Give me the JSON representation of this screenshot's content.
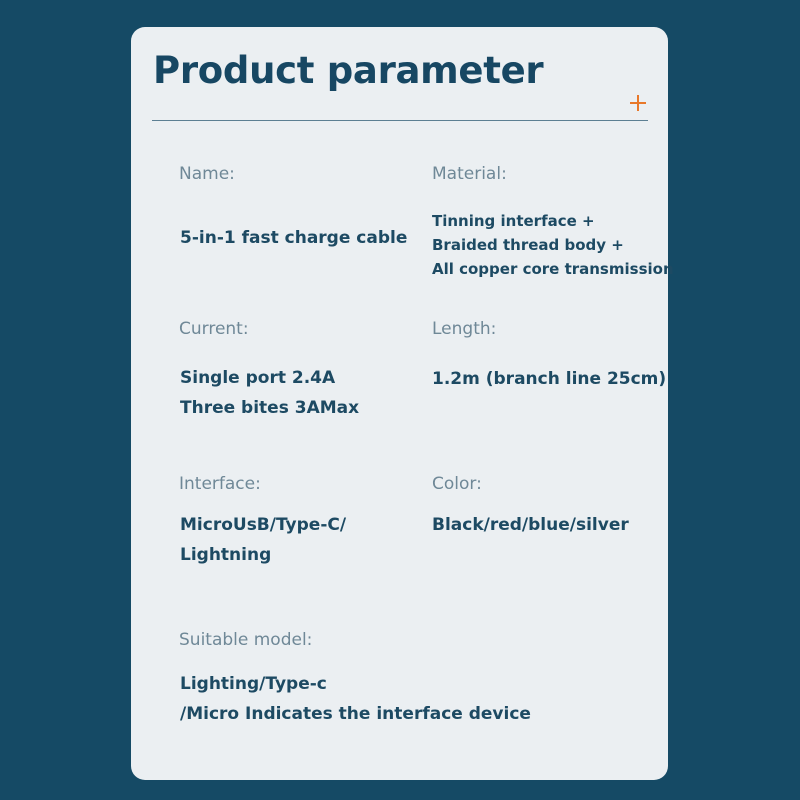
{
  "card": {
    "title": "Product parameter"
  },
  "params": {
    "name": {
      "label": "Name:",
      "value": "5-in-1 fast charge cable"
    },
    "material": {
      "label": "Material:",
      "lines": [
        "Tinning interface +",
        "Braided thread body +",
        "All copper core transmission"
      ]
    },
    "current": {
      "label": "Current:",
      "lines": [
        "Single port 2.4A",
        "Three bites 3AMax"
      ]
    },
    "length": {
      "label": "Length:",
      "value": "1.2m (branch line 25cm)"
    },
    "interface": {
      "label": "Interface:",
      "lines": [
        "MicroUsB/Type-C/",
        "Lightning"
      ]
    },
    "color": {
      "label": "Color:",
      "value": "Black/red/blue/silver"
    },
    "suitable_model": {
      "label": "Suitable model:",
      "lines": [
        "Lighting/Type-c",
        "/Micro Indicates the interface device"
      ]
    }
  },
  "colors": {
    "page_background": "#154a65",
    "card_background": "#ebeff2",
    "accent": "#e8782a",
    "heading": "#174763",
    "label": "#6f8897"
  },
  "icons": {
    "plus": "plus-icon"
  }
}
